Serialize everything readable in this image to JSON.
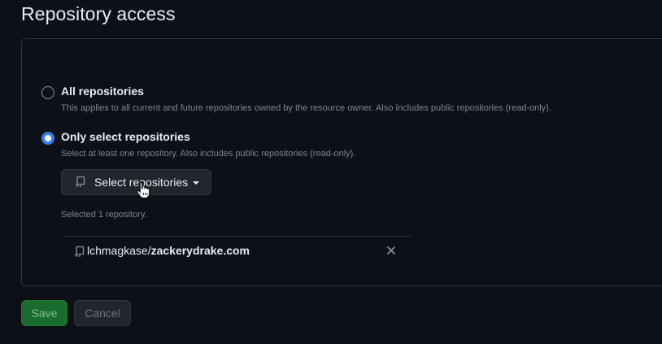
{
  "section": {
    "title": "Repository access"
  },
  "options": {
    "all": {
      "label": "All repositories",
      "description": "This applies to all current and future repositories owned by the resource owner. Also includes public repositories (read-only).",
      "checked": false
    },
    "select": {
      "label": "Only select repositories",
      "description": "Select at least one repository. Also includes public repositories (read-only).",
      "checked": true
    }
  },
  "selector": {
    "button_label": "Select repositories",
    "selected_text": "Selected 1 repository."
  },
  "selected_repos": [
    {
      "owner": "lchmagkase/",
      "name": "zackerydrake.com"
    }
  ],
  "actions": {
    "save_label": "Save",
    "cancel_label": "Cancel"
  },
  "colors": {
    "background": "#0d1117",
    "accent": "#2f81f7",
    "save_green": "#196c2e",
    "border": "#30363d"
  }
}
